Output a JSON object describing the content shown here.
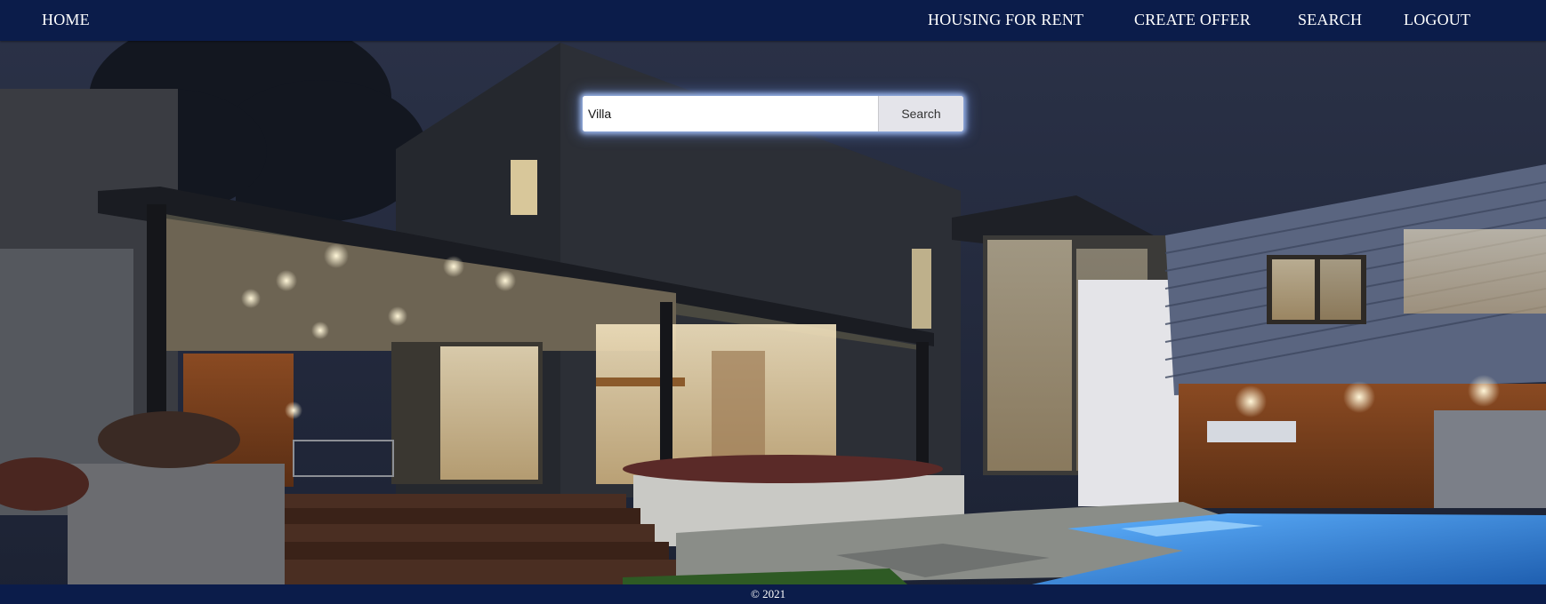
{
  "navbar": {
    "home": "HOME",
    "housing_for_rent": "HOUSING FOR RENT",
    "create_offer": "CREATE OFFER",
    "search": "SEARCH",
    "logout": "LOGOUT"
  },
  "search": {
    "value": "Villa",
    "button_label": "Search"
  },
  "footer": {
    "copyright": "© 2021"
  },
  "background": {
    "description_icon": "modern-villa-at-night-photo",
    "colors": {
      "navbar": "#0b1c4a",
      "sky": "#222a3d",
      "pool": "#3f8fe6"
    }
  }
}
